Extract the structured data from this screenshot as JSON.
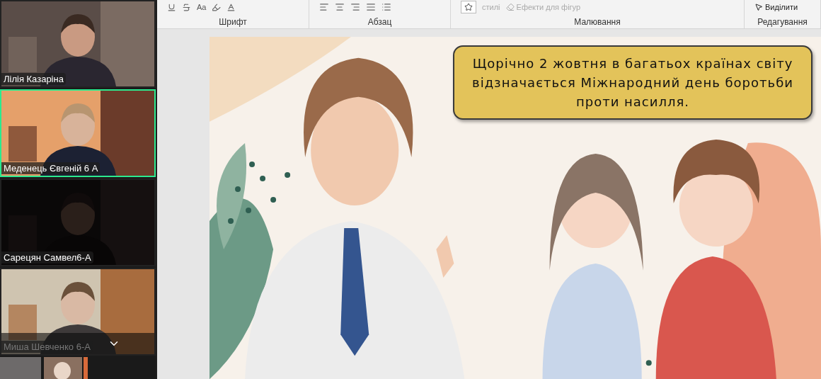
{
  "participants": [
    {
      "name": "Лілія Казаріна",
      "active": false,
      "dimmed": false
    },
    {
      "name": "Меденець Євгеній 6 А",
      "active": true,
      "dimmed": false
    },
    {
      "name": "Сарецян Самвел6-А",
      "active": false,
      "dimmed": false
    },
    {
      "name": "Миша Шевченко 6-А",
      "active": false,
      "dimmed": true
    }
  ],
  "ribbon": {
    "font_buttons": [
      "Aa"
    ],
    "groups": [
      {
        "label": "Шрифт",
        "kind": "font"
      },
      {
        "label": "Абзац",
        "kind": "paragraph"
      },
      {
        "label": "Малювання",
        "kind": "drawing",
        "buttons": [
          {
            "label": "стилі",
            "disabled": true
          },
          {
            "label": "Ефекти для фігур",
            "disabled": true
          }
        ]
      },
      {
        "label": "Редагування",
        "kind": "editing",
        "buttons": [
          {
            "label": "Виділити",
            "disabled": false
          }
        ]
      }
    ]
  },
  "slide": {
    "callout": "Щорічно 2 жовтня в багатьох країнах світу відзначається Міжнародний день боротьби проти насилля."
  }
}
